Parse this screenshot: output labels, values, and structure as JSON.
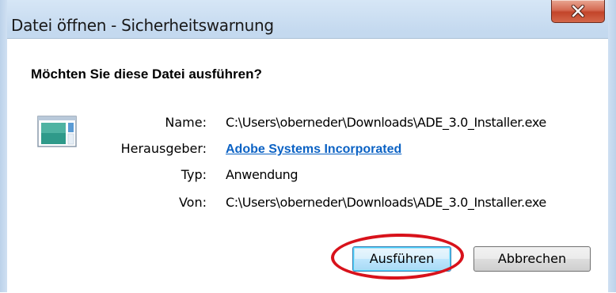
{
  "window": {
    "title": "Datei öffnen - Sicherheitswarnung",
    "close_icon": "close-x-icon"
  },
  "dialog": {
    "question": "Möchten Sie diese Datei ausführen?",
    "file_icon": "application-window-icon",
    "fields": {
      "name_label": "Name:",
      "name_value": "C:\\Users\\oberneder\\Downloads\\ADE_3.0_Installer.exe",
      "publisher_label": "Herausgeber:",
      "publisher_value": "Adobe Systems Incorporated",
      "type_label": "Typ:",
      "type_value": "Anwendung",
      "from_label": "Von:",
      "from_value": "C:\\Users\\oberneder\\Downloads\\ADE_3.0_Installer.exe"
    },
    "buttons": {
      "run_label": "Ausführen",
      "cancel_label": "Abbrechen"
    }
  },
  "colors": {
    "link": "#0b62c4",
    "highlight_ring": "#d8121b",
    "close_button": "#c2442a"
  }
}
